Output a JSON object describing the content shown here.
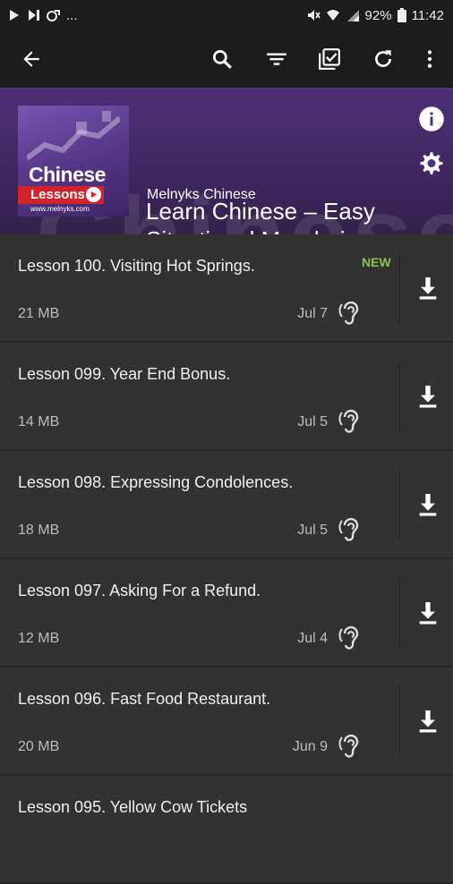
{
  "status": {
    "time": "11:42",
    "battery": "92%",
    "ellipsis": "..."
  },
  "podcast": {
    "title_line1": "Learn Chinese – Easy",
    "title_line2": "Situational Mandarin ...",
    "author": "Melnyks Chinese",
    "cover_title": "Chinese",
    "cover_subtitle": "Lessons",
    "cover_url": "www.melnyks.com",
    "watermark": "Chinese"
  },
  "episodes": [
    {
      "title": "Lesson 100. Visiting Hot Springs.",
      "size": "21 MB",
      "date": "Jul 7",
      "badge": "NEW"
    },
    {
      "title": "Lesson 099. Year End Bonus.",
      "size": "14 MB",
      "date": "Jul 5",
      "badge": ""
    },
    {
      "title": "Lesson 098. Expressing Condolences.",
      "size": "18 MB",
      "date": "Jul 5",
      "badge": ""
    },
    {
      "title": "Lesson 097. Asking For a Refund.",
      "size": "12 MB",
      "date": "Jul 4",
      "badge": ""
    },
    {
      "title": "Lesson 096. Fast Food Restaurant.",
      "size": "20 MB",
      "date": "Jun 9",
      "badge": ""
    },
    {
      "title": "Lesson 095. Yellow Cow Tickets",
      "size": "",
      "date": "",
      "badge": ""
    }
  ],
  "colors": {
    "accent_new": "#8bc34a",
    "header_purple": "#4e2f78",
    "background": "#323232",
    "toolbar": "#1c1c1c"
  }
}
